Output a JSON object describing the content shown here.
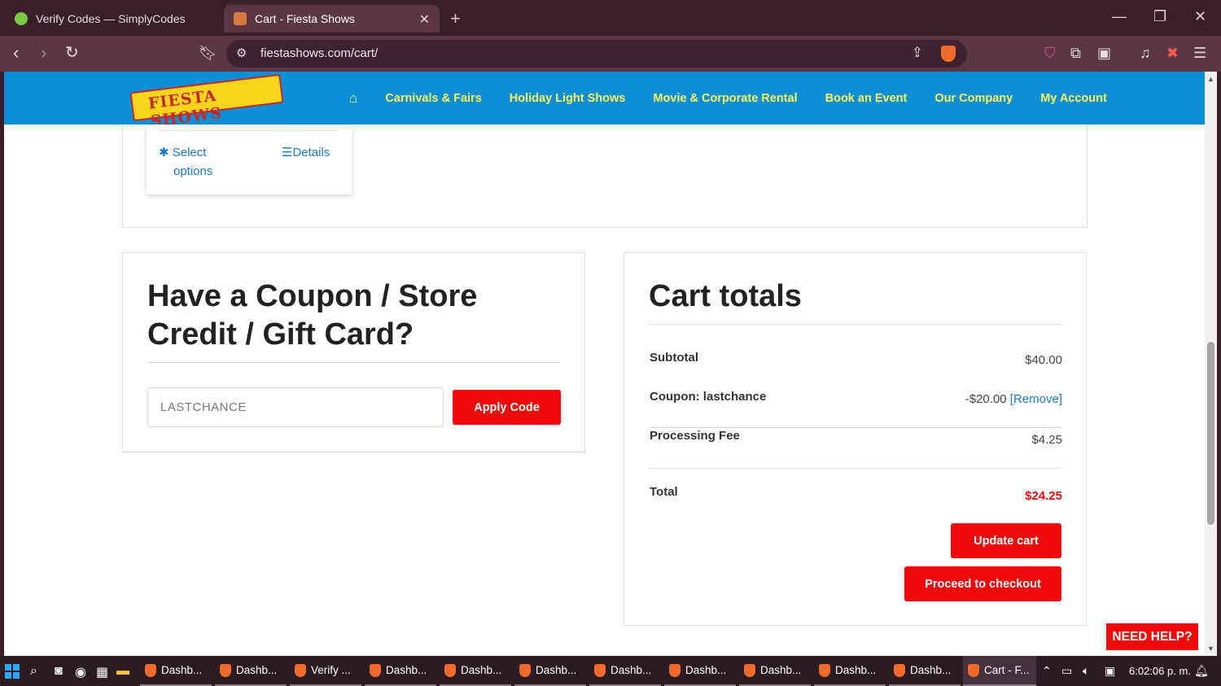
{
  "browser": {
    "tabs": [
      {
        "title": "Verify Codes — SimplyCodes",
        "icon": "simplycodes-icon"
      },
      {
        "title": "Cart - Fiesta Shows",
        "icon": "fiesta-favicon-icon"
      }
    ],
    "url": "fiestashows.com/cart/"
  },
  "site": {
    "logo_text": "FIESTA SHOWS",
    "nav": [
      "Carnivals & Fairs",
      "Holiday Light Shows",
      "Movie & Corporate Rental",
      "Book an Event",
      "Our Company",
      "My Account"
    ],
    "colors": {
      "header": "#0a8fd6",
      "nav_text": "#fff65a",
      "accent_red": "#ee0a0a"
    }
  },
  "product_card": {
    "select_label": "Select",
    "select_label2": "options",
    "details_label": "Details"
  },
  "coupon": {
    "title": "Have a Coupon / Store Credit / Gift Card?",
    "input_value": "LASTCHANCE",
    "apply_label": "Apply Code"
  },
  "totals": {
    "title": "Cart totals",
    "subtotal_label": "Subtotal",
    "subtotal_value": "$40.00",
    "coupon_label": "Coupon: lastchance",
    "coupon_value": "-$20.00",
    "coupon_remove": "[Remove]",
    "fee_label": "Processing Fee",
    "fee_value": "$4.25",
    "total_label": "Total",
    "total_value": "$24.25",
    "update_label": "Update cart",
    "checkout_label": "Proceed to checkout"
  },
  "help_label": "NEED HELP?",
  "taskbar": {
    "items": [
      "Dashb...",
      "Dashb...",
      "Verify ...",
      "Dashb...",
      "Dashb...",
      "Dashb...",
      "Dashb...",
      "Dashb...",
      "Dashb...",
      "Dashb...",
      "Dashb...",
      "Cart - F..."
    ],
    "clock": "6:02:06 p. m."
  }
}
